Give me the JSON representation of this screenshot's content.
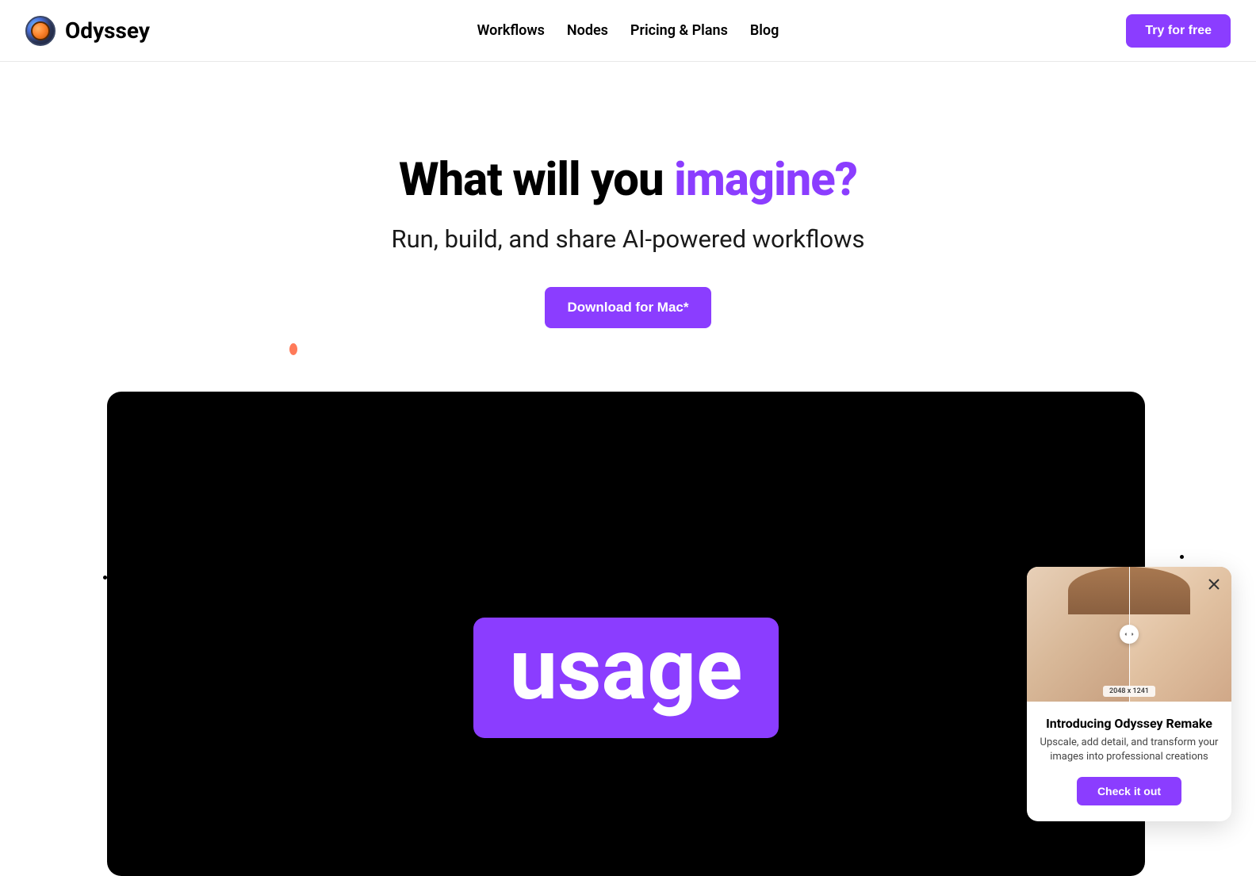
{
  "header": {
    "logo_text": "Odyssey",
    "nav": [
      {
        "label": "Workflows"
      },
      {
        "label": "Nodes"
      },
      {
        "label": "Pricing & Plans"
      },
      {
        "label": "Blog"
      }
    ],
    "cta_label": "Try for free"
  },
  "hero": {
    "title_prefix": "What will you ",
    "title_accent": "imagine?",
    "subtitle": "Run, build, and share AI-powered workflows",
    "download_label": "Download for Mac*"
  },
  "video": {
    "overlay_text": "usage"
  },
  "popup": {
    "dimensions": "2048 x 1241",
    "title": "Introducing Odyssey Remake",
    "description": "Upscale, add detail, and transform your images into professional creations",
    "button_label": "Check it out"
  }
}
